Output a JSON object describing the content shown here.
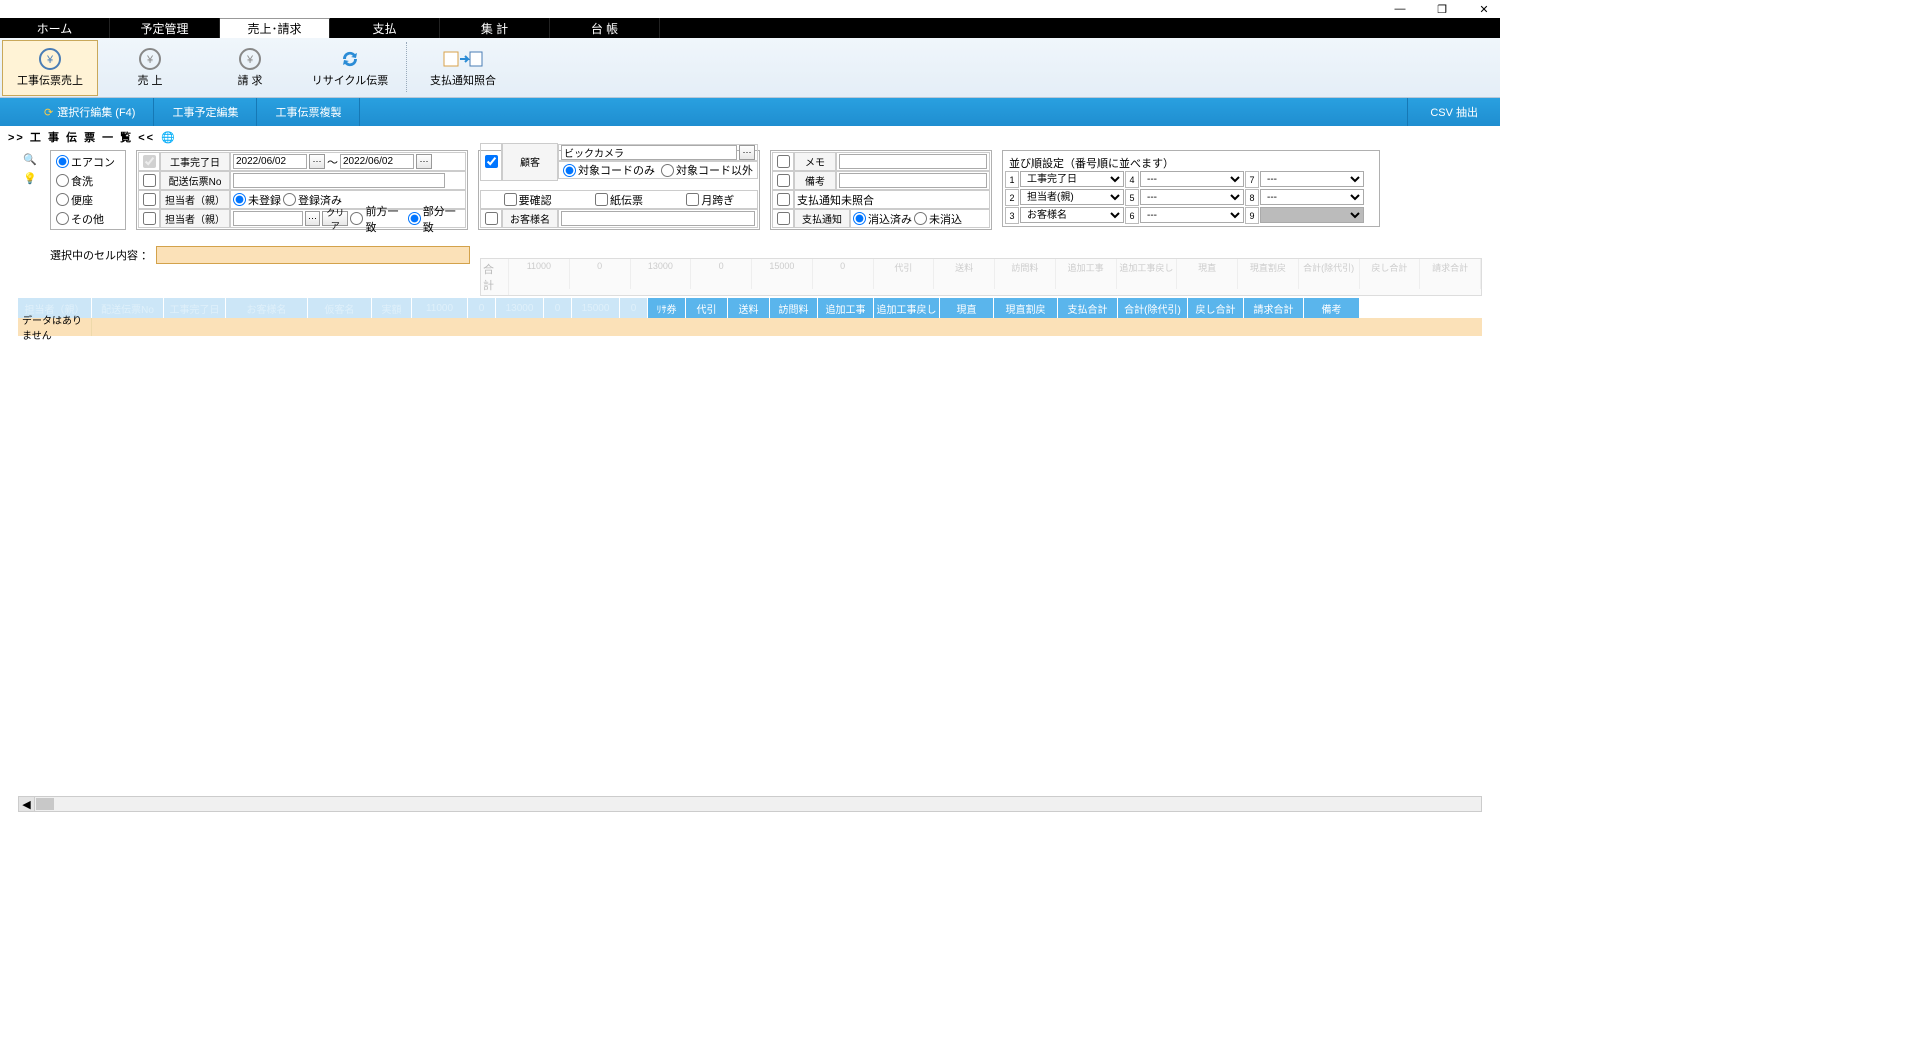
{
  "window": {
    "minimize": "—",
    "maximize": "❐",
    "close": "✕"
  },
  "tabs": [
    "ホーム",
    "予定管理",
    "売上･請求",
    "支払",
    "集 計",
    "台 帳"
  ],
  "ribbon": {
    "b1": "工事伝票売上",
    "b2": "売 上",
    "b3": "請 求",
    "b4": "リサイクル伝票",
    "b5": "支払通知照合"
  },
  "subtb": {
    "s1": "選択行編集 (F4)",
    "s2": "工事予定編集",
    "s3": "工事伝票複製",
    "right": "CSV 抽出"
  },
  "section": {
    "title": ">> 工 事 伝 票 一 覧 <<"
  },
  "f1": {
    "o1": "エアコン",
    "o2": "食洗",
    "o3": "便座",
    "o4": "その他"
  },
  "f2": {
    "r1l": "工事完了日",
    "d1": "2022/06/02",
    "tilde": "～",
    "d2": "2022/06/02",
    "r2l": "配送伝票No",
    "r3l": "担当者（親）",
    "r3a": "未登録",
    "r3b": "登録済み",
    "r4l": "担当者（親）",
    "clr": "クリア",
    "r4a": "前方一致",
    "r4b": "部分一致"
  },
  "f3": {
    "r1l": "顧客",
    "r1v": "ビックカメラ",
    "r2a": "対象コードのみ",
    "r2b": "対象コード以外",
    "r3a": "要確認",
    "r3b": "紙伝票",
    "r3c": "月跨ぎ",
    "r4l": "お客様名"
  },
  "f4": {
    "r1l": "メモ",
    "r2l": "備考",
    "r3l": "支払通知未照合",
    "r4l": "支払通知",
    "r4a": "消込済み",
    "r4b": "未消込"
  },
  "f5": {
    "title": "並び順設定（番号順に並べます）",
    "s1": "工事完了日",
    "s2": "担当者(親)",
    "s3": "お客様名",
    "dash": "---"
  },
  "selrow": {
    "label": "選択中のセル内容 ："
  },
  "sum": {
    "lead1": "合",
    "lead2": "計",
    "v": [
      "11000",
      "0",
      "13000",
      "0",
      "15000",
      "0",
      "代引",
      "送料",
      "訪問料",
      "追加工事",
      "追加工事戻し",
      "現直",
      "現直割戻",
      "合計(除代引)",
      "戻し合計",
      "請求合計"
    ]
  },
  "grid": {
    "h_faded": [
      "担当者（親）",
      "配送伝票No",
      "工事完了日",
      "お客様名",
      "仮客名",
      "実額",
      "11000",
      "0",
      "13000",
      "0",
      "15000",
      "0"
    ],
    "h": [
      "ﾘｻ券",
      "代引",
      "送料",
      "訪問料",
      "追加工事",
      "追加工事戻し",
      "現直",
      "現直割戻",
      "支払合計",
      "合計(除代引)",
      "戻し合計",
      "請求合計",
      "備考"
    ],
    "nodata": "データはありません"
  }
}
